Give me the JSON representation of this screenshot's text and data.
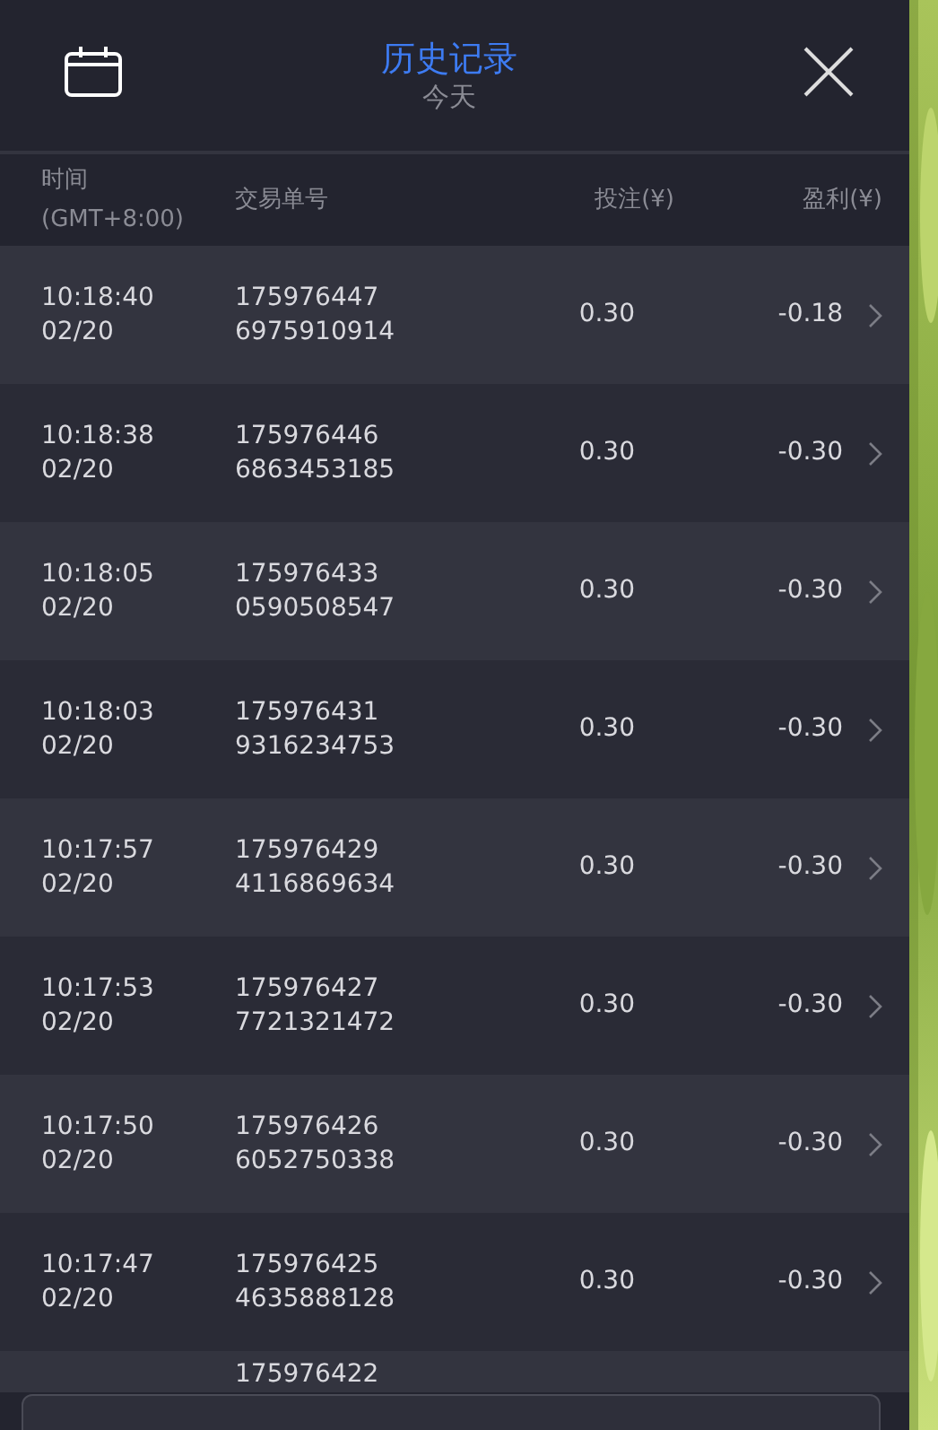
{
  "header": {
    "title": "历史记录",
    "subtitle": "今天"
  },
  "columns": [
    {
      "kind": "time",
      "lines": [
        "时间",
        "(GMT+8:00)"
      ]
    },
    {
      "kind": "order",
      "lines": [
        "交易单号"
      ]
    },
    {
      "kind": "stake",
      "lines": [
        "投注(¥)"
      ]
    },
    {
      "kind": "profit",
      "lines": [
        "盈利(¥)"
      ]
    }
  ],
  "rows": [
    {
      "time": "10:18:40",
      "date": "02/20",
      "order": [
        "175976447",
        "6975910914"
      ],
      "stake": "0.30",
      "profit": "-0.18"
    },
    {
      "time": "10:18:38",
      "date": "02/20",
      "order": [
        "175976446",
        "6863453185"
      ],
      "stake": "0.30",
      "profit": "-0.30"
    },
    {
      "time": "10:18:05",
      "date": "02/20",
      "order": [
        "175976433",
        "0590508547"
      ],
      "stake": "0.30",
      "profit": "-0.30"
    },
    {
      "time": "10:18:03",
      "date": "02/20",
      "order": [
        "175976431",
        "9316234753"
      ],
      "stake": "0.30",
      "profit": "-0.30"
    },
    {
      "time": "10:17:57",
      "date": "02/20",
      "order": [
        "175976429",
        "4116869634"
      ],
      "stake": "0.30",
      "profit": "-0.30"
    },
    {
      "time": "10:17:53",
      "date": "02/20",
      "order": [
        "175976427",
        "7721321472"
      ],
      "stake": "0.30",
      "profit": "-0.30"
    },
    {
      "time": "10:17:50",
      "date": "02/20",
      "order": [
        "175976426",
        "6052750338"
      ],
      "stake": "0.30",
      "profit": "-0.30"
    },
    {
      "time": "10:17:47",
      "date": "02/20",
      "order": [
        "175976425",
        "4635888128"
      ],
      "stake": "0.30",
      "profit": "-0.30"
    },
    {
      "order": [
        "175976422"
      ]
    }
  ]
}
